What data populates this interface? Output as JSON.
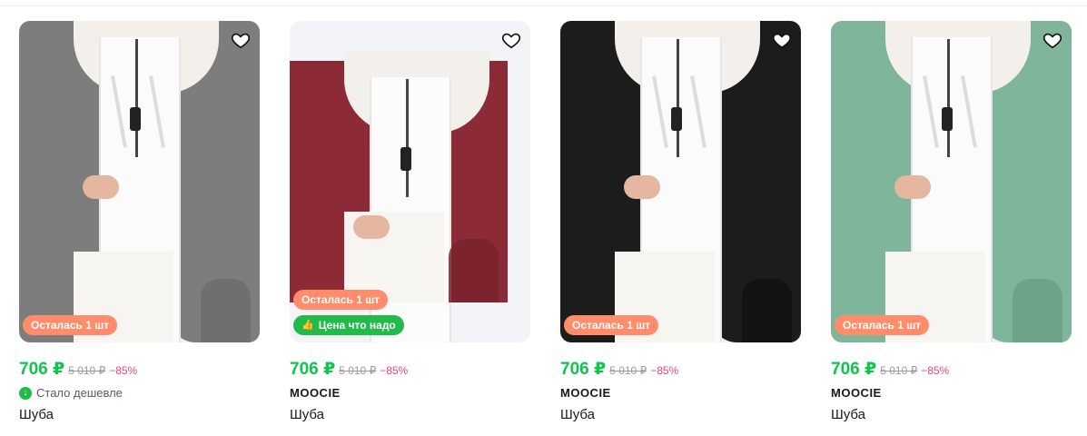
{
  "products": [
    {
      "jacket_color": "#7d7d7d",
      "jacket_shade": "#6c6c6c",
      "stock_badge": "Осталась 1 шт",
      "deal_badge": "",
      "price": "706 ₽",
      "old_price": "5 010 ₽",
      "discount": "−85%",
      "note": "Стало дешевле",
      "brand": "",
      "name": "Шуба"
    },
    {
      "jacket_color": "#8c2a35",
      "jacket_shade": "#7a222c",
      "stock_badge": "Осталась 1 шт",
      "deal_badge": "Цена что надо",
      "price": "706 ₽",
      "old_price": "5 010 ₽",
      "discount": "−85%",
      "note": "",
      "brand": "MOOCIE",
      "name": "Шуба"
    },
    {
      "jacket_color": "#1c1c1c",
      "jacket_shade": "#111111",
      "stock_badge": "Осталась 1 шт",
      "deal_badge": "",
      "price": "706 ₽",
      "old_price": "5 010 ₽",
      "discount": "−85%",
      "note": "",
      "brand": "MOOCIE",
      "name": "Шуба"
    },
    {
      "jacket_color": "#7fb59a",
      "jacket_shade": "#6aa086",
      "stock_badge": "Осталась 1 шт",
      "deal_badge": "",
      "price": "706 ₽",
      "old_price": "5 010 ₽",
      "discount": "−85%",
      "note": "",
      "brand": "MOOCIE",
      "name": "Шуба"
    }
  ],
  "icons": {
    "favorite": "heart-outline-icon",
    "deal": "thumbs-up-icon",
    "cheaper": "arrow-down-circle-icon"
  }
}
